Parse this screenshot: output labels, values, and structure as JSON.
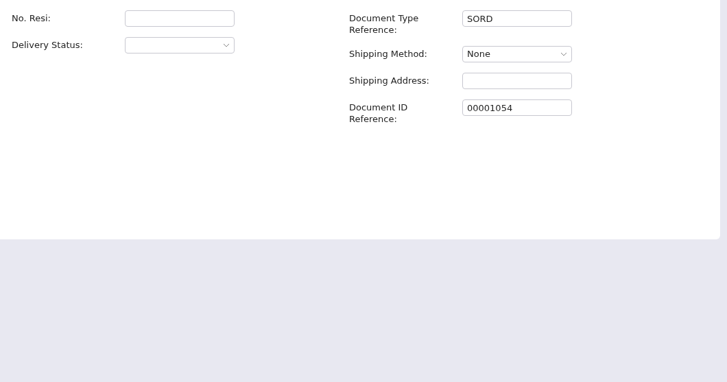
{
  "form": {
    "left_fields": [
      {
        "label": "No. Resi:",
        "kind": "input"
      },
      {
        "label": "Delivery Status:",
        "kind": "select"
      }
    ],
    "right_fields": [
      {
        "label": "Document Type Reference:",
        "kind": "input",
        "value": "SORD"
      },
      {
        "label": "Shipping Method:",
        "kind": "select",
        "value": "None"
      },
      {
        "label": "Shipping Address:",
        "kind": "input"
      },
      {
        "label": "Document ID Reference:",
        "kind": "input",
        "value": "00001054"
      }
    ]
  }
}
